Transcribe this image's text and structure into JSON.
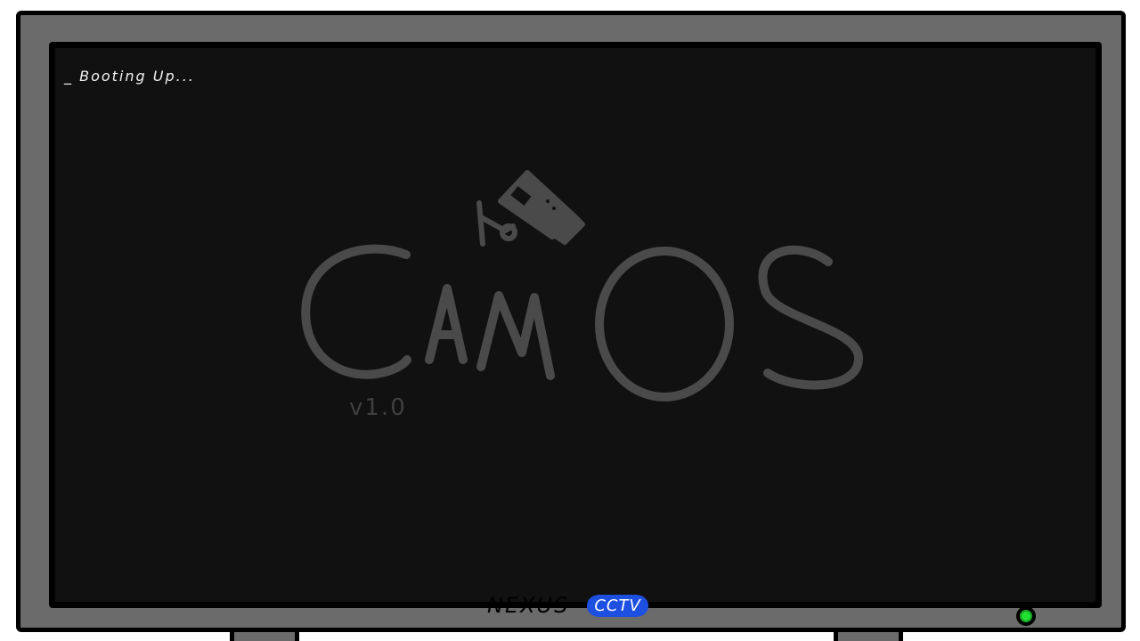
{
  "screen": {
    "boot_status": "_ Booting Up...",
    "logo": {
      "text": "CamOS",
      "version": "v1.0",
      "icon": "security-camera-icon"
    }
  },
  "monitor": {
    "brand_name": "NEXUS",
    "brand_badge": "CCTV",
    "power_led": "power-led-icon"
  },
  "colors": {
    "screen_bg": "#111111",
    "bezel": "#6b6b6b",
    "logo": "#4a4a4a",
    "badge": "#1d4fe0",
    "led": "#22e030"
  }
}
